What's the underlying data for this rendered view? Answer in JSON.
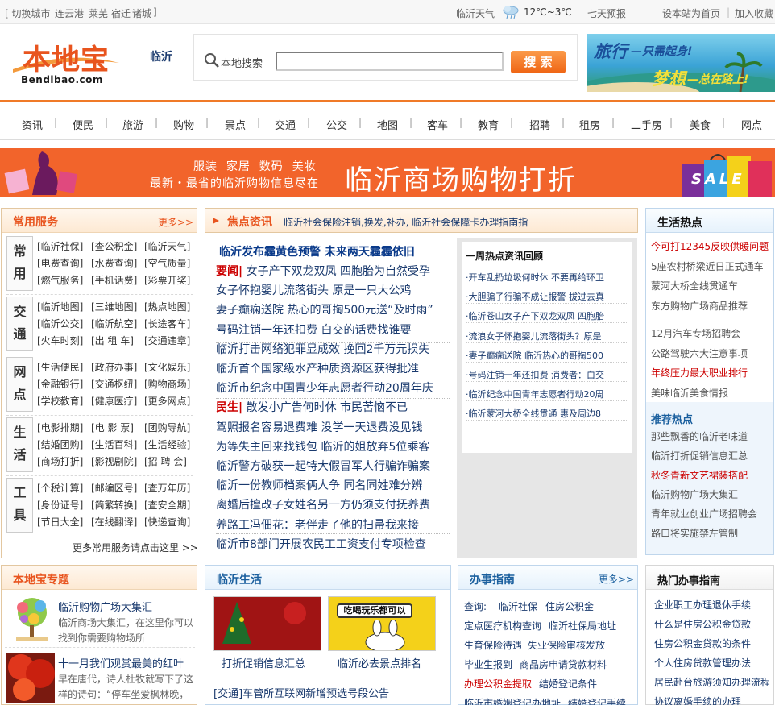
{
  "topbar": {
    "switch_city": "[ 切换城市",
    "cities": [
      "连云港",
      "莱芜",
      "宿迁",
      "诸城"
    ],
    "close_bracket": "]",
    "weather_city": "临沂天气",
    "temp": "12℃~3℃",
    "forecast": "七天预报",
    "set_home": "设本站为首页",
    "bar": "|",
    "add_fav": "加入收藏"
  },
  "header": {
    "logo_cn": "本地宝",
    "logo_en": "Bendibao.com",
    "city": "临沂",
    "search_label": "本地搜索",
    "search_value": "",
    "search_button": "搜 索",
    "ad_line1a": "旅行",
    "ad_line1b": "—只需起身!",
    "ad_line2a": "梦想",
    "ad_line2b": "—总在路上!"
  },
  "nav": [
    "资讯",
    "便民",
    "旅游",
    "购物",
    "景点",
    "交通",
    "公交",
    "地图",
    "客车",
    "教育",
    "招聘",
    "租房",
    "二手房",
    "美食",
    "网点"
  ],
  "shop_banner": {
    "tags": "服装  家居  数码  美妆",
    "sub": "最新・最省的临沂购物信息尽在",
    "title": "临沂商场购物打折",
    "sale": "SALE"
  },
  "services": {
    "title": "常用服务",
    "more": "更多>>",
    "groups": [
      {
        "cat": [
          "常",
          "用"
        ],
        "links": [
          "[临沂社保]",
          "[查公积金]",
          "[临沂天气]",
          "[电费查询]",
          "[水费查询]",
          "[空气质量]",
          "[燃气服务]",
          "[手机话费]",
          "[彩票开奖]"
        ]
      },
      {
        "cat": [
          "交",
          "通"
        ],
        "links": [
          "[临沂地图]",
          "[三维地图]",
          "[热点地图]",
          "[临沂公交]",
          "[临沂航空]",
          "[长途客车]",
          "[火车时刻]",
          "[出 租 车]",
          "[交通违章]"
        ]
      },
      {
        "cat": [
          "网",
          "点"
        ],
        "links": [
          "[生活便民]",
          "[政府办事]",
          "[文化娱乐]",
          "[金融银行]",
          "[交通枢纽]",
          "[购物商场]",
          "[学校教育]",
          "[健康医疗]",
          "[更多网点]"
        ]
      },
      {
        "cat": [
          "生",
          "活"
        ],
        "links": [
          "[电影排期]",
          "[电 影 票]",
          "[团购导航]",
          "[结婚团购]",
          "[生活百科]",
          "[生活经验]",
          "[商场打折]",
          "[影视剧院]",
          "[招 聘 会]"
        ]
      },
      {
        "cat": [
          "工",
          "具"
        ],
        "links": [
          "[个税计算]",
          "[邮编区号]",
          "[查万年历]",
          "[身份证号]",
          "[简繁转换]",
          "[查安全期]",
          "[节日大全]",
          "[在线翻译]",
          "[快递查询]"
        ]
      }
    ],
    "footer": "更多常用服务请点击这里 >>"
  },
  "focus": {
    "title": "焦点资讯",
    "ticker": "临沂社会保险注销,换发,补办, 临沂社会保障卡办理指南指",
    "headline": "临沂发布霾黄色预警  未来两天霾霾依旧",
    "items": [
      {
        "pre": "要闻|",
        "text": " 女子产下双龙双凤  四胞胎为自然受孕"
      },
      {
        "pre": "",
        "text": "女子怀抱婴儿流落街头  原是一只大公鸡"
      },
      {
        "pre": "",
        "text": "妻子癫痫送院  热心的哥掏500元送“及时雨”"
      },
      {
        "pre": "",
        "text": "号码注销一年还扣费  白交的话费找谁要"
      },
      {
        "pre": "",
        "text": "临沂打击网络犯罪显成效  挽回2千万元损失"
      },
      {
        "pre": "",
        "text": "临沂首个国家级水产种质资源区获得批准"
      },
      {
        "pre": "",
        "text": "临沂市纪念中国青少年志愿者行动20周年庆"
      },
      {
        "pre": "民生|",
        "text": " 散发小广告何时休  市民苦恼不已"
      },
      {
        "pre": "",
        "text": "驾照报名容易退费难  没学一天退费没见钱"
      },
      {
        "pre": "",
        "text": "为等失主回来找钱包  临沂的姐放弃5位乘客"
      },
      {
        "pre": "",
        "text": "临沂警方破获一起特大假冒军人行骗诈骗案"
      },
      {
        "pre": "",
        "text": "临沂一份教师档案俩人争  同名同姓难分辨"
      },
      {
        "pre": "",
        "text": "离婚后擅改子女姓名另一方仍须支付抚养费"
      },
      {
        "pre": "",
        "text": "养路工冯佃花：老伴走了他的扫帚我来接"
      },
      {
        "pre": "",
        "text": "临沂市8部门开展农民工工资支付专项检查"
      }
    ],
    "hot_title": "一周热点资讯回顾",
    "hot": [
      "·开车乱扔垃圾何时休  不要再给环卫",
      "·大胆骗子行骗不成让报警  拔过去真",
      "·临沂苍山女子产下双龙双凤  四胞胎",
      "·流浪女子怀抱婴儿流落街头？原是",
      "·妻子癫痫送院  临沂热心的哥掏500",
      "·号码注销一年还扣费  消费者：白交",
      "·临沂纪念中国青年志愿者行动20周",
      "·临沂蒙河大桥全线贯通  惠及周边8"
    ]
  },
  "life_hot": {
    "title": "生活热点",
    "items": [
      {
        "text": "今可打12345反映供暖问题",
        "red": true
      },
      {
        "text": "5座农村桥梁近日正式通车",
        "red": false
      },
      {
        "text": "蒙河大桥全线贯通车",
        "red": false
      },
      {
        "text": "东方购物广场商品推荐",
        "red": false
      },
      {
        "text": "12月汽车专场招聘会",
        "red": false
      },
      {
        "text": "公路驾驶六大注意事项",
        "red": false
      },
      {
        "text": "年终压力最大职业排行",
        "red": true
      },
      {
        "text": "美味临沂美食情报",
        "red": false
      }
    ],
    "rec_title": "推荐热点",
    "rec": [
      {
        "text": "那些飘香的临沂老味道",
        "red": false
      },
      {
        "text": "临沂打折促销信息汇总",
        "red": false
      },
      {
        "text": "秋冬青新文艺裙装搭配",
        "red": true
      },
      {
        "text": "临沂购物广场大集汇",
        "red": false
      },
      {
        "text": "青年就业创业广场招聘会",
        "red": false
      },
      {
        "text": "路口将实施禁左管制",
        "red": false
      }
    ]
  },
  "topics": {
    "title": "本地宝专题",
    "items": [
      {
        "title": "临沂购物广场大集汇",
        "desc": "临沂商场大集汇，在这里你可以找到你需要购物场所"
      },
      {
        "title": "十一月我们观赏最美的红叶",
        "desc": "早在唐代，诗人杜牧就写下了这样的诗句：“停车坐爱枫林晚，"
      }
    ]
  },
  "living": {
    "title": "临沂生活",
    "img1_caption": "打折促销信息汇总",
    "img2_caption": "临沂必去景点排名",
    "img2_text": "吃喝玩乐都可以",
    "link": "[交通]车管所互联网新增预选号段公告"
  },
  "guide": {
    "title": "办事指南",
    "more": "更多>>",
    "query_label": "查询:",
    "rows": [
      [
        "临沂社保",
        "住房公积金"
      ],
      [
        "定点医疗机构查询",
        "临沂社保局地址"
      ],
      [
        "生育保险待遇",
        "失业保险审核发放"
      ],
      [
        "毕业生报到",
        "商品房申请贷款材料"
      ],
      [
        "办理公积金提取",
        "结婚登记条件"
      ],
      [
        "临沂市婚姻登记办地址",
        "结婚登记手续"
      ]
    ]
  },
  "hot_guide": {
    "title": "热门办事指南",
    "items": [
      "企业职工办理退休手续",
      "什么是住房公积金贷款",
      "住房公积金贷款的条件",
      "个人住房贷款管理办法",
      "居民赴台旅游须知办理流程",
      "协议离婚手续的办理"
    ]
  },
  "colors": {
    "brand_orange": "#e8541e",
    "nav_orange": "#f07a28",
    "link_blue": "#1a3a6e",
    "red": "#cc0000"
  }
}
